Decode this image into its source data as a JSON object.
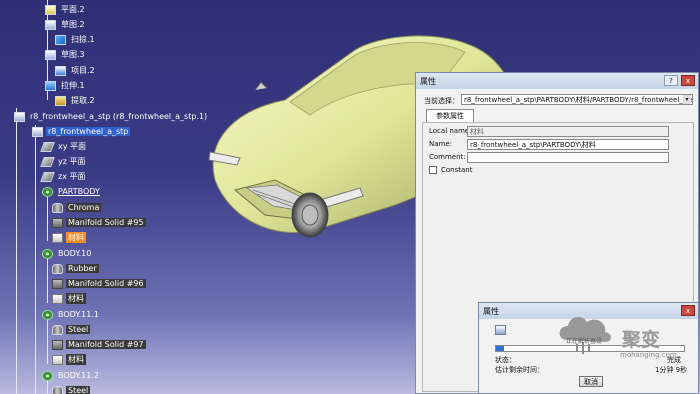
{
  "tree": {
    "items": [
      {
        "label": "平面.2"
      },
      {
        "label": "草图.2"
      },
      {
        "label": "扫掠.1"
      },
      {
        "label": "草图.3"
      },
      {
        "label": "项目.2"
      },
      {
        "label": "拉伸.1"
      },
      {
        "label": "提取.2"
      },
      {
        "label": "r8_frontwheel_a_stp (r8_frontwheel_a_stp.1)"
      },
      {
        "label": "r8_frontwheel_a_stp"
      },
      {
        "label": "xy 平面"
      },
      {
        "label": "yz 平面"
      },
      {
        "label": "zx 平面"
      },
      {
        "label": "PARTBODY"
      },
      {
        "label": "Chroma"
      },
      {
        "label": "Manifold Solid #95"
      },
      {
        "label": "材料"
      },
      {
        "label": "BODY.10"
      },
      {
        "label": "Rubber"
      },
      {
        "label": "Manifold Solid #96"
      },
      {
        "label": "材料"
      },
      {
        "label": "BODY.11.1"
      },
      {
        "label": "Steel"
      },
      {
        "label": "Manifold Solid #97"
      },
      {
        "label": "材料"
      },
      {
        "label": "BODY.11.2"
      },
      {
        "label": "Steel"
      }
    ]
  },
  "properties_dialog": {
    "title": "属性",
    "help_btn": "?",
    "close_btn": "x",
    "selection_label": "当前选择：",
    "selection_value": "r8_frontwheel_a_stp\\PARTBODY\\材料/PARTBODY/r8_frontwheel_a_stp",
    "tab": "参数属性",
    "local_name_label": "Local name:",
    "local_name_value": "材料",
    "name_label": "Name:",
    "name_value": "r8_frontwheel_a_stp\\PARTBODY\\材料",
    "comment_label": "Comment:",
    "comment_value": "",
    "constant_label": "Constant"
  },
  "progress_dialog": {
    "title": "属性",
    "close_btn": "x",
    "status_label": "状态：",
    "time_label": "估计剩余时间：",
    "status_value": "完成",
    "time_value": "1分钟 9秒",
    "cancel_btn": "取消",
    "progress": 0.04
  },
  "watermark": {
    "brand_cn": "聚变",
    "brand_url": "mohanging.com",
    "small_text": "正在解析器设"
  },
  "colors": {
    "car_body": "#e4eaa0",
    "bg_top": "#2f2f75",
    "tree_selected": "#3060d0",
    "tree_highlight": "#ff8a1f"
  }
}
